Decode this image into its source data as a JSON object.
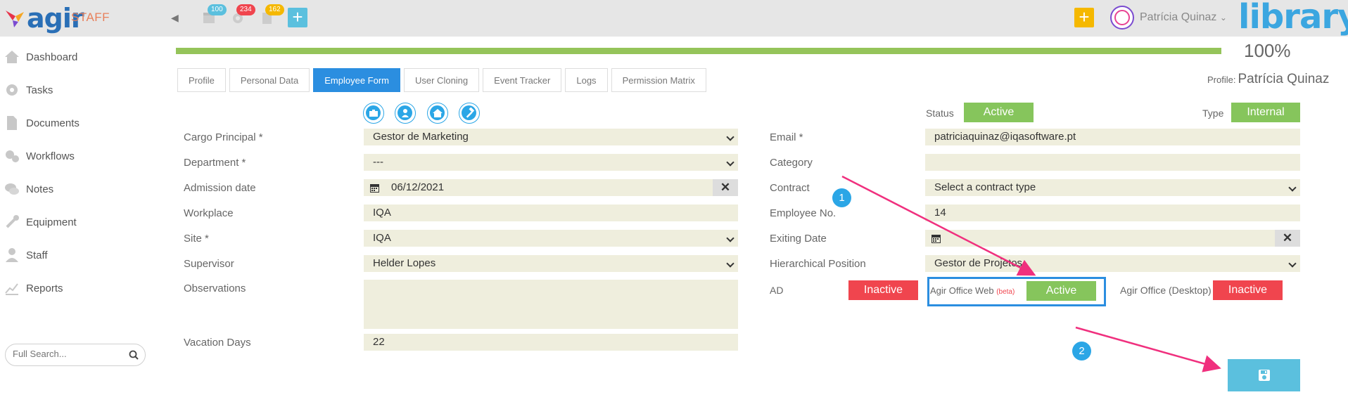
{
  "topbar": {
    "logo_text": "agir",
    "app_label": "STAFF",
    "badges": {
      "calendar": "100",
      "tasks": "234",
      "documents": "162"
    },
    "add_label": "+",
    "user_name": "Patrícia Quinaz",
    "library_logo": "library"
  },
  "sidebar": {
    "items": [
      {
        "label": "Dashboard",
        "icon": "home-icon"
      },
      {
        "label": "Tasks",
        "icon": "gear-icon"
      },
      {
        "label": "Documents",
        "icon": "document-icon"
      },
      {
        "label": "Workflows",
        "icon": "gears-icon"
      },
      {
        "label": "Notes",
        "icon": "chat-icon"
      },
      {
        "label": "Equipment",
        "icon": "wrench-icon"
      },
      {
        "label": "Staff",
        "icon": "user-icon"
      },
      {
        "label": "Reports",
        "icon": "chart-icon"
      }
    ],
    "search_placeholder": "Full Search..."
  },
  "progress": {
    "value": 100,
    "label": "100%"
  },
  "tabs": [
    {
      "label": "Profile",
      "active": false
    },
    {
      "label": "Personal Data",
      "active": false
    },
    {
      "label": "Employee Form",
      "active": true
    },
    {
      "label": "User Cloning",
      "active": false
    },
    {
      "label": "Event Tracker",
      "active": false
    },
    {
      "label": "Logs",
      "active": false
    },
    {
      "label": "Permission Matrix",
      "active": false
    }
  ],
  "profile": {
    "prefix": "Profile:",
    "name": "Patrícia Quinaz"
  },
  "status": {
    "label": "Status",
    "value": "Active",
    "type_label": "Type",
    "type_value": "Internal"
  },
  "left_form": {
    "cargo": {
      "label": "Cargo Principal *",
      "value": "Gestor de Marketing"
    },
    "department": {
      "label": "Department *",
      "value": "---"
    },
    "admission": {
      "label": "Admission date",
      "value": "06/12/2021"
    },
    "workplace": {
      "label": "Workplace",
      "value": "IQA"
    },
    "site": {
      "label": "Site *",
      "value": "IQA"
    },
    "supervisor": {
      "label": "Supervisor",
      "value": "Helder Lopes"
    },
    "observations": {
      "label": "Observations",
      "value": ""
    },
    "vacation": {
      "label": "Vacation Days",
      "value": "22"
    }
  },
  "right_form": {
    "email": {
      "label": "Email *",
      "value": "patriciaquinaz@iqasoftware.pt"
    },
    "category": {
      "label": "Category",
      "value": ""
    },
    "contract": {
      "label": "Contract",
      "value": "Select a contract type"
    },
    "employee_no": {
      "label": "Employee No.",
      "value": "14"
    },
    "exiting": {
      "label": "Exiting Date",
      "value": ""
    },
    "hierarchical": {
      "label": "Hierarchical Position",
      "value": "Gestor de Projetos"
    }
  },
  "access": {
    "ad_label": "AD",
    "ad_value": "Inactive",
    "web_label": "Agir Office Web",
    "web_beta": "(beta)",
    "web_value": "Active",
    "desktop_label": "Agir Office (Desktop)",
    "desktop_value": "Inactive"
  },
  "steps": {
    "one": "1",
    "two": "2"
  },
  "colors": {
    "accent": "#2b8ee0",
    "green": "#86c55c",
    "red": "#f0454e",
    "field": "#efeedd",
    "arrow": "#f0307e"
  }
}
